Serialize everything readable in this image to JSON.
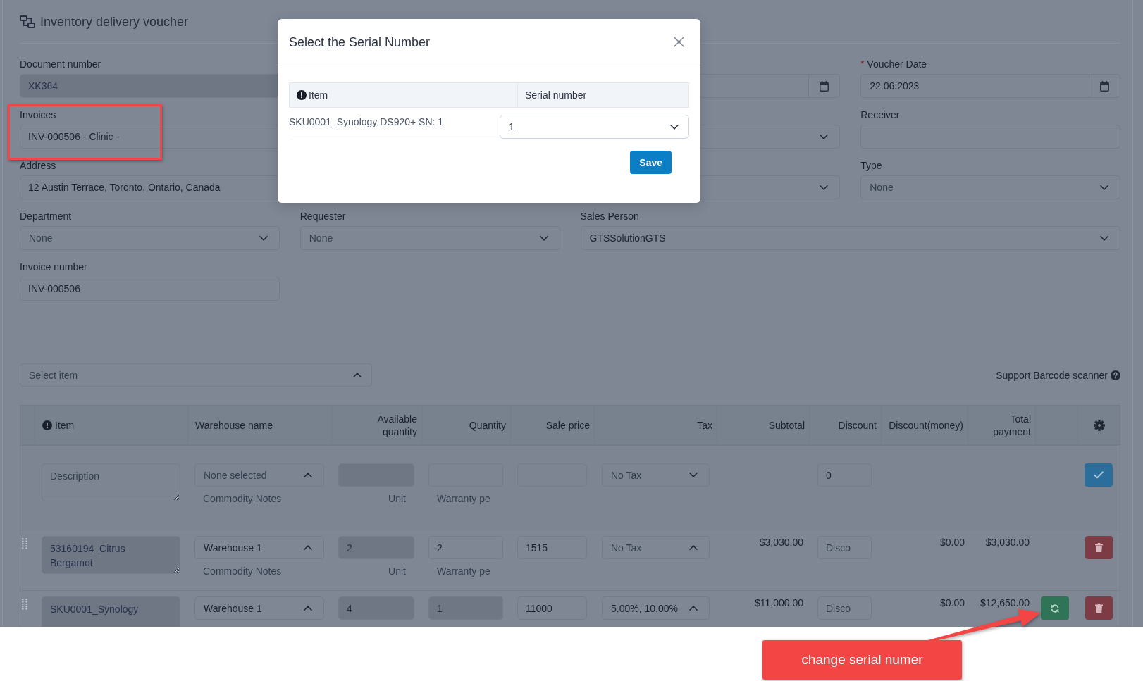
{
  "page": {
    "title": "Inventory delivery voucher"
  },
  "form": {
    "rows": [
      {
        "fields": [
          {
            "kind": "text",
            "label": "Document number",
            "value": "XK364",
            "disabled": true
          },
          {
            "kind": "date"
          },
          {
            "kind": "date",
            "label": "Voucher Date",
            "required_mark": "*",
            "value": "22.06.2023",
            "disabled": false
          }
        ]
      },
      {
        "fields": [
          {
            "kind": "text",
            "label": "Invoices",
            "value": "INV-000506 - Clinic -",
            "disabled": false
          },
          {
            "kind": "select",
            "caret_up": false
          },
          {
            "kind": "text",
            "label": "Receiver",
            "disabled": false
          }
        ]
      },
      {
        "fields": [
          {
            "kind": "text",
            "label": "Address",
            "value": "12 Austin Terrace, Toronto, Ontario, Canada",
            "disabled": false
          },
          {
            "kind": "select",
            "caret_up": false
          },
          {
            "kind": "select",
            "label": "Type",
            "placeholder": "None",
            "caret_up": false,
            "disabled": false
          }
        ]
      },
      {
        "fields": [
          {
            "kind": "select",
            "label": "Department",
            "placeholder": "None",
            "caret_up": false,
            "disabled": false
          },
          {
            "kind": "select",
            "label": "Requester",
            "placeholder": "None",
            "caret_up": false,
            "disabled": false
          },
          {
            "kind": "select",
            "label": "Sales Person",
            "value": "GTSSolutionGTS",
            "caret_up": false,
            "disabled": false
          }
        ]
      },
      {
        "fields": [
          {
            "kind": "text",
            "label": "Invoice number",
            "value": "INV-000506",
            "disabled": false
          }
        ]
      }
    ]
  },
  "item_picker": {
    "placeholder": "Select item",
    "caret_up": true
  },
  "barcode_hint": {
    "label": "Support Barcode scanner"
  },
  "table": {
    "columns": [
      "Item",
      "Warehouse name",
      "Available quantity",
      "Quantity",
      "Sale price",
      "Tax",
      "Subtotal",
      "Discount",
      "Discount(money)",
      "Total payment"
    ],
    "rows": [
      {
        "kind": "entry",
        "description": {
          "placeholder": "Description",
          "disabled": false
        },
        "warehouse": {
          "placeholder": "None selected",
          "caret_up": true
        },
        "notes": {
          "placeholder": "Commodity Notes"
        },
        "available": {
          "disabled": true
        },
        "unit": {
          "placeholder": "Unit"
        },
        "quantity": {
          "disabled": false
        },
        "warranty": {
          "placeholder": "Warranty pe"
        },
        "sale_price": {
          "disabled": false
        },
        "tax": {
          "placeholder": "No Tax",
          "caret_up": false
        },
        "discount": {
          "value": "0"
        },
        "actions": [
          {
            "kind": "confirm"
          }
        ]
      },
      {
        "kind": "item",
        "description": {
          "value": "53160194_Citrus Bergamot",
          "disabled": true
        },
        "warehouse": {
          "value": "Warehouse 1",
          "caret_up": true
        },
        "notes": {
          "placeholder": "Commodity Notes"
        },
        "available": {
          "value": "2",
          "disabled": true
        },
        "unit": {
          "placeholder": "Unit"
        },
        "quantity": {
          "value": "2",
          "disabled": false
        },
        "warranty": {
          "placeholder": "Warranty pe"
        },
        "sale_price": {
          "value": "1515",
          "disabled": false
        },
        "tax": {
          "placeholder": "No Tax",
          "caret_up": true
        },
        "subtotal": "$3,030.00",
        "discount": {
          "placeholder": "Disco"
        },
        "discount_money": "$0.00",
        "total_payment": "$3,030.00",
        "actions": [
          {
            "kind": "delete"
          }
        ]
      },
      {
        "kind": "item",
        "description": {
          "value": "SKU0001_Synology",
          "disabled": true
        },
        "warehouse": {
          "value": "Warehouse 1",
          "caret_up": true
        },
        "available": {
          "value": "4",
          "disabled": true
        },
        "quantity": {
          "value": "1",
          "disabled": true
        },
        "sale_price": {
          "value": "11000",
          "disabled": false
        },
        "tax": {
          "value": "5.00%, 10.00%",
          "caret_up": true
        },
        "subtotal": "$11,000.00",
        "discount": {
          "placeholder": "Disco"
        },
        "discount_money": "$0.00",
        "total_payment": "$12,650.00",
        "actions": [
          {
            "kind": "refresh"
          },
          {
            "kind": "delete"
          }
        ]
      }
    ]
  },
  "modal": {
    "title": "Select the Serial Number",
    "columns": [
      "Item",
      "Serial number"
    ],
    "rows": [
      {
        "item": "SKU0001_Synology DS920+ SN: 1",
        "serial": {
          "value": "1",
          "caret_up": false
        }
      }
    ],
    "buttons": [
      {
        "label": "Save"
      }
    ]
  },
  "callout": {
    "text": "change serial numer"
  }
}
